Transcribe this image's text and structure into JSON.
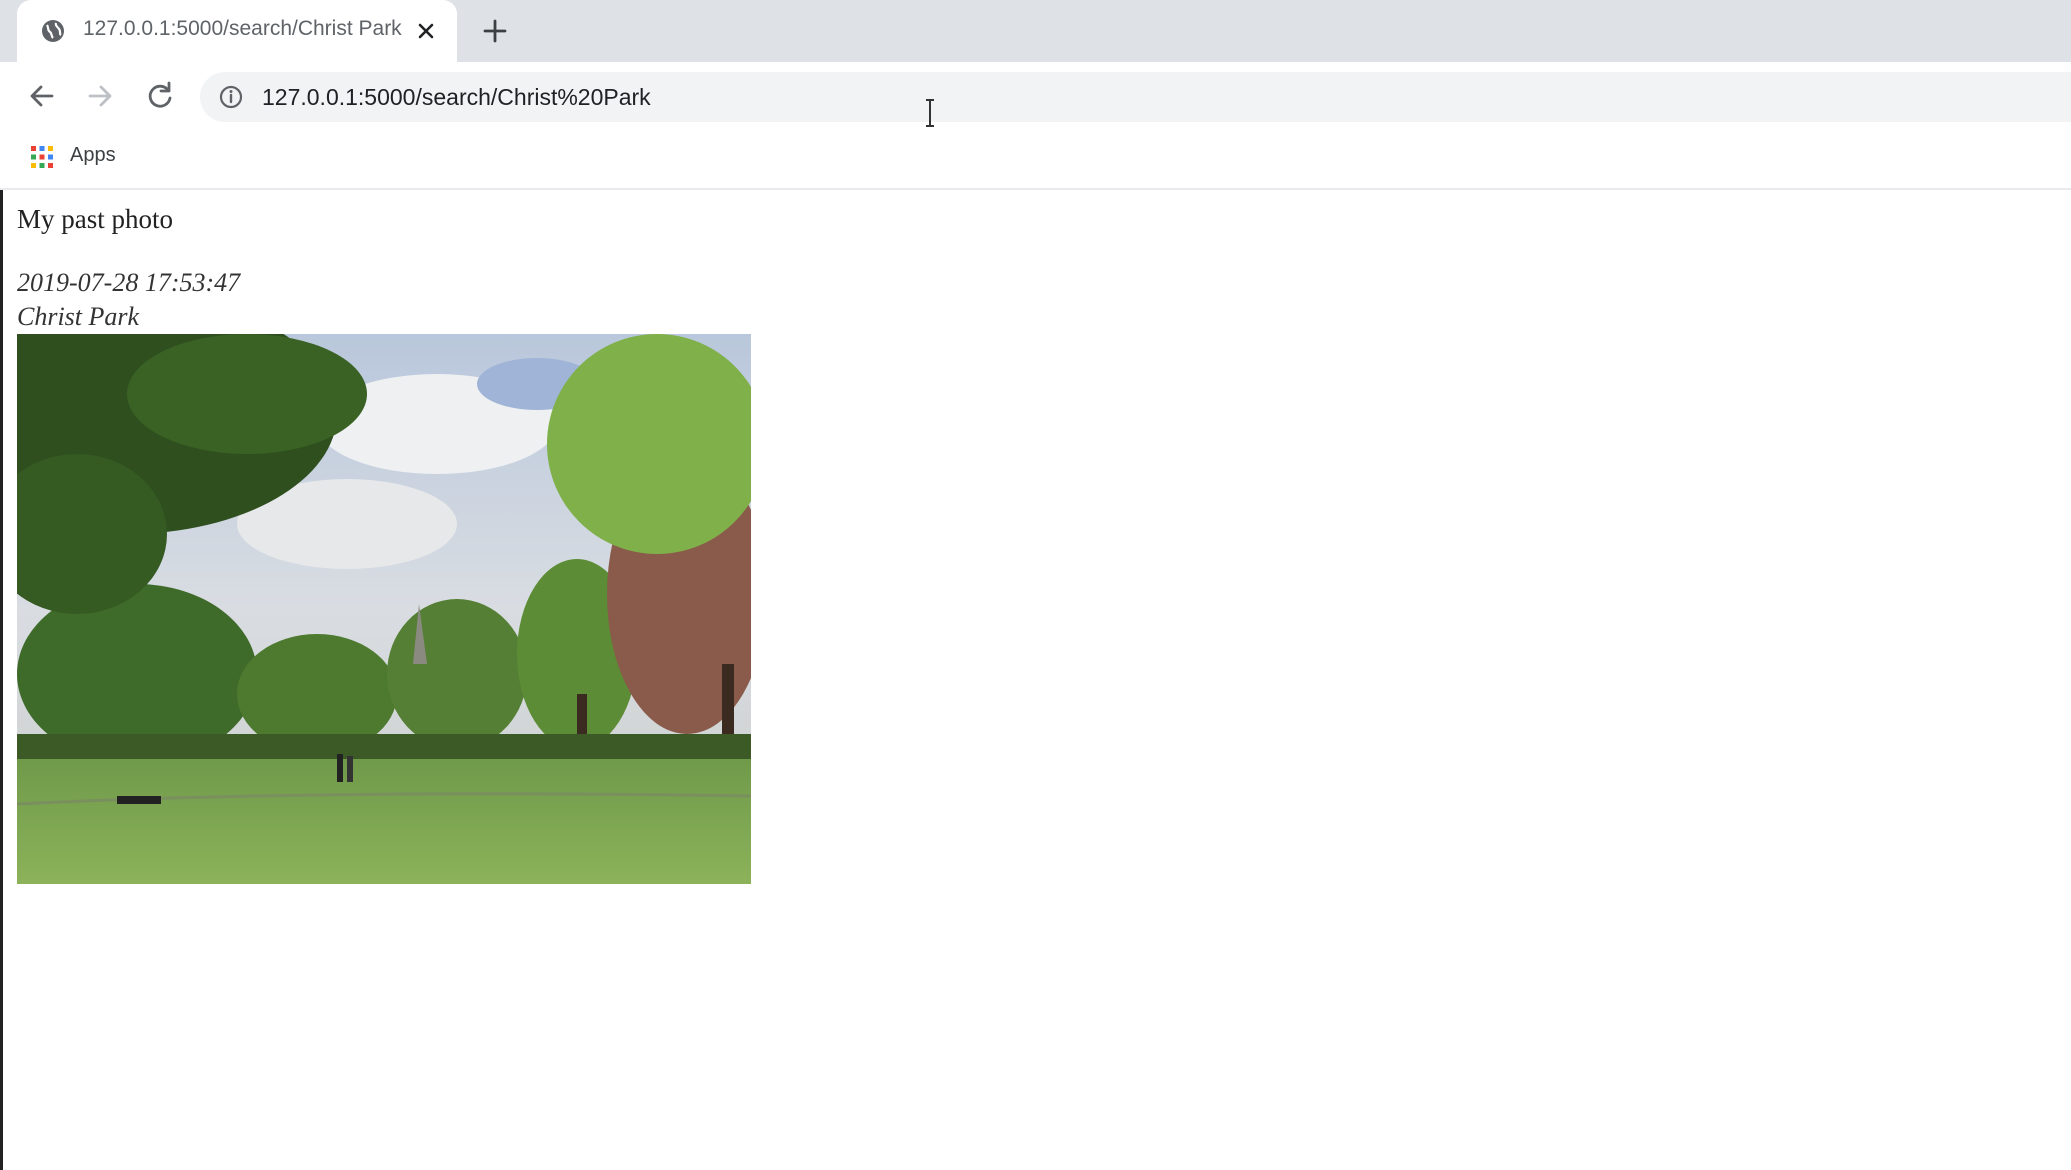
{
  "browser": {
    "tab": {
      "title": "127.0.0.1:5000/search/Christ Park",
      "favicon": "globe-icon",
      "close_icon": "close-icon"
    },
    "new_tab_icon": "plus-icon",
    "nav": {
      "back_icon": "arrow-left-icon",
      "forward_icon": "arrow-right-icon",
      "reload_icon": "reload-icon"
    },
    "address_bar": {
      "info_icon": "info-icon",
      "url": "127.0.0.1:5000/search/Christ%20Park"
    },
    "bookmarks_bar": {
      "apps_icon": "apps-grid-icon",
      "apps_label": "Apps"
    }
  },
  "page": {
    "heading": "My past photo",
    "entry": {
      "timestamp": "2019-07-28 17:53:47",
      "location": "Christ Park",
      "photo": "park-photo"
    }
  },
  "colors": {
    "tabstrip": "#dee1e6",
    "omnibox": "#f1f3f4",
    "text": "#202124"
  }
}
